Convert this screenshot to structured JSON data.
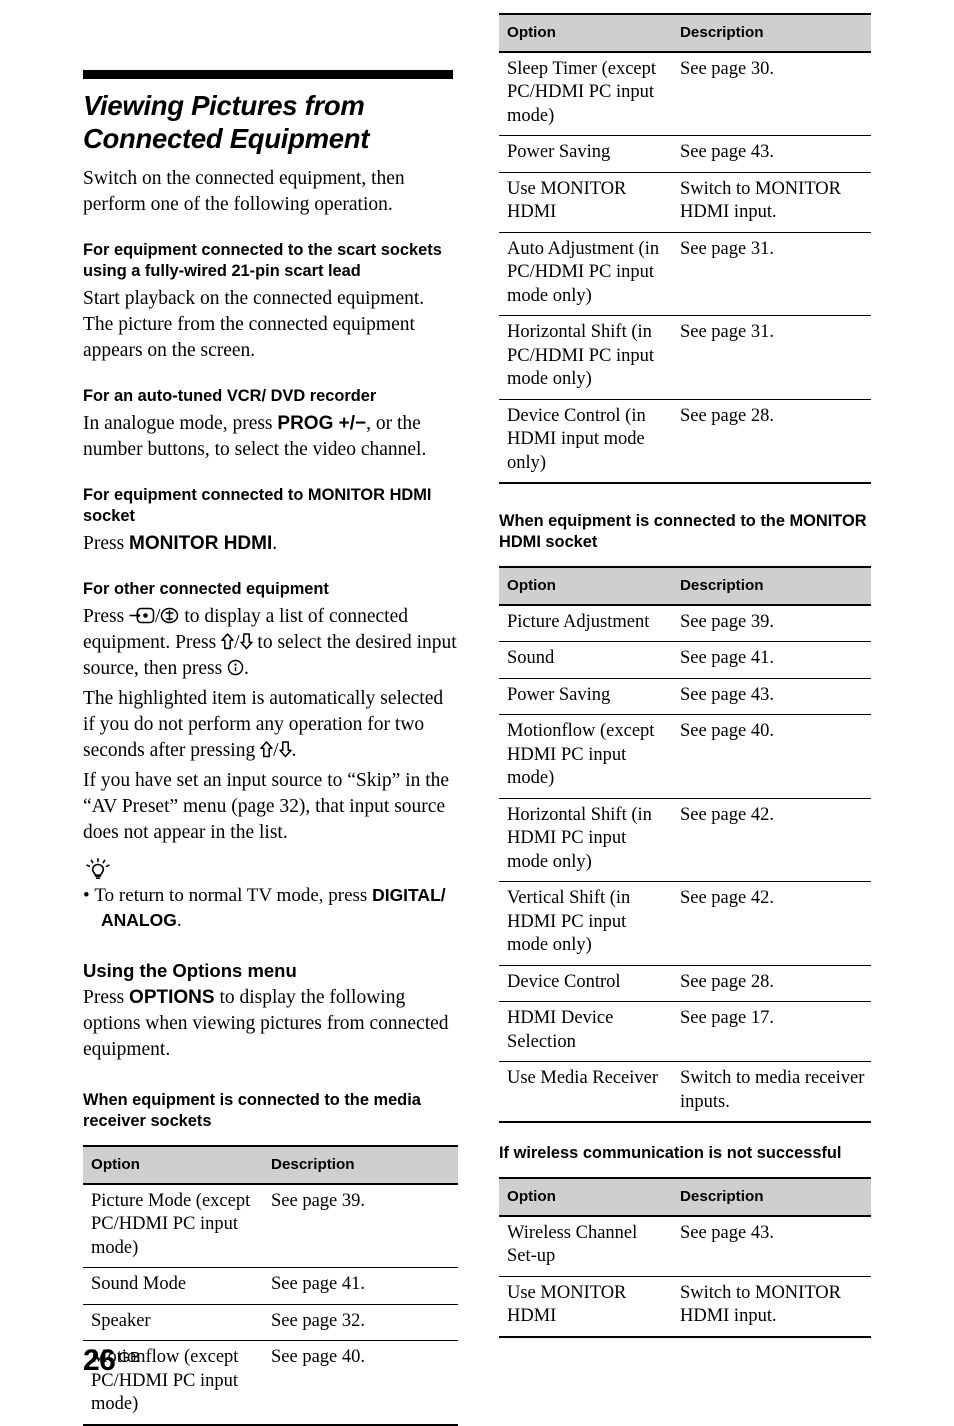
{
  "page": {
    "number": "26",
    "region": "GB"
  },
  "heading": {
    "title": "Viewing Pictures from Connected Equipment"
  },
  "intro": {
    "text": "Switch on the connected equipment, then perform one of the following operation."
  },
  "sections": [
    {
      "id": "scart",
      "heading": "For equipment connected to the scart sockets using a fully-wired 21-pin scart lead",
      "body": "Start playback on the connected equipment. The picture from the connected equipment appears on the screen."
    },
    {
      "id": "vcr",
      "heading": "For an auto-tuned VCR/ DVD recorder",
      "body_part1": "In analogue mode, press ",
      "body_key": "PROG +/−",
      "body_part2": ", or the number buttons, to select the video channel."
    },
    {
      "id": "monitor-hdmi",
      "heading": "For equipment connected to MONITOR HDMI socket",
      "body_part1": "Press ",
      "body_key": "MONITOR HDMI",
      "body_part2": "."
    },
    {
      "id": "other",
      "heading": "For other connected equipment",
      "line1_a": "Press ",
      "line1_b": "/",
      "line1_c": " to display a list of connected equipment. Press ",
      "line1_d": "/",
      "line1_e": " to select the desired input source, then press ",
      "line1_f": ".",
      "line2": "The highlighted item is automatically selected if you do not perform any operation for two seconds after pressing ",
      "line2_b": "/",
      "line2_c": ".",
      "line3": "If you have set an input source to “Skip” in the “AV Preset” menu (page 32), that input source does not appear in the list."
    }
  ],
  "tip": {
    "icon": "lightbulb-tip-icon",
    "item_a": "To return to normal TV mode, press ",
    "item_key1": "DIGITAL/",
    "item_key2": "ANALOG",
    "item_b": "."
  },
  "options_menu": {
    "heading": "Using the Options menu",
    "body_a": "Press ",
    "body_key": "OPTIONS",
    "body_b": " to display the following options when viewing pictures from connected equipment."
  },
  "table_headers": {
    "option": "Option",
    "description": "Description"
  },
  "tables": [
    {
      "id": "media-receiver",
      "heading": "When equipment is connected to the media receiver sockets",
      "rows_left_column": [
        {
          "option": "Picture Mode (except PC/HDMI PC input mode)",
          "description": "See page 39."
        },
        {
          "option": "Sound Mode",
          "description": "See page 41."
        },
        {
          "option": "Speaker",
          "description": "See page 32."
        },
        {
          "option": "Motionflow (except PC/HDMI PC input mode)",
          "description": "See page 40."
        }
      ],
      "rows_right_column": [
        {
          "option": "Sleep Timer (except PC/HDMI PC input mode)",
          "description": "See page 30."
        },
        {
          "option": "Power Saving",
          "description": "See page 43."
        },
        {
          "option": "Use MONITOR HDMI",
          "description": "Switch to MONITOR HDMI input."
        },
        {
          "option": "Auto Adjustment (in PC/HDMI PC input mode only)",
          "description": "See page 31."
        },
        {
          "option": "Horizontal Shift (in PC/HDMI PC input mode only)",
          "description": "See page 31."
        },
        {
          "option": "Device Control (in HDMI input mode only)",
          "description": "See page 28."
        }
      ]
    },
    {
      "id": "monitor-hdmi-socket",
      "heading": "When equipment is connected to the MONITOR HDMI socket",
      "rows": [
        {
          "option": "Picture Adjustment",
          "description": "See page 39."
        },
        {
          "option": "Sound",
          "description": "See page 41."
        },
        {
          "option": "Power Saving",
          "description": "See page 43."
        },
        {
          "option": "Motionflow (except HDMI PC input mode)",
          "description": "See page 40."
        },
        {
          "option": "Horizontal Shift (in HDMI PC input mode only)",
          "description": "See page 42."
        },
        {
          "option": "Vertical Shift (in HDMI PC input mode only)",
          "description": "See page 42."
        },
        {
          "option": "Device Control",
          "description": "See page 28."
        },
        {
          "option": "HDMI Device Selection",
          "description": "See page 17."
        },
        {
          "option": "Use Media Receiver",
          "description": "Switch to media receiver inputs."
        }
      ]
    },
    {
      "id": "wireless",
      "heading": "If wireless communication is not successful",
      "rows": [
        {
          "option": "Wireless Channel Set-up",
          "description": "See page 43."
        },
        {
          "option": "Use MONITOR HDMI",
          "description": "Switch to MONITOR HDMI input."
        }
      ]
    }
  ]
}
